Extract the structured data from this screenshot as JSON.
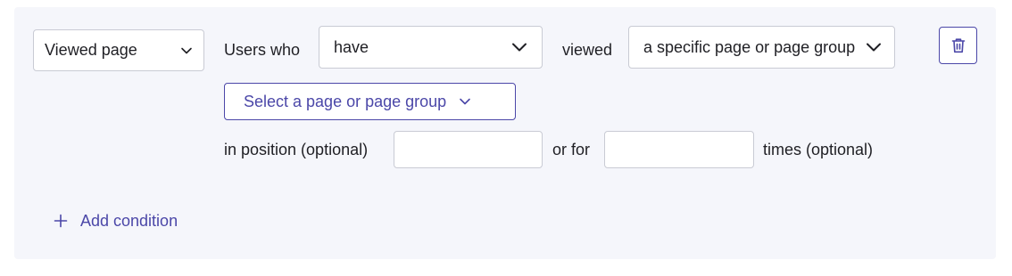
{
  "condition": {
    "event_select": {
      "value": "Viewed page"
    },
    "users_who_label": "Users who",
    "have_select": {
      "value": "have"
    },
    "viewed_label": "viewed",
    "target_select": {
      "value": "a specific page or page group"
    },
    "page_picker": {
      "label": "Select a page or page group"
    },
    "position_label": "in position (optional)",
    "position_input": {
      "value": "",
      "placeholder": ""
    },
    "or_for_label": "or for",
    "times_input": {
      "value": "",
      "placeholder": ""
    },
    "times_label": "times (optional)",
    "delete_icon": "trash-icon"
  },
  "footer": {
    "add_condition_label": "Add condition",
    "add_icon": "plus-icon"
  },
  "colors": {
    "accent": "#4b47a8",
    "panel_bg": "#f5f6fb",
    "border": "#c9cbd4",
    "text": "#1f1f24"
  }
}
